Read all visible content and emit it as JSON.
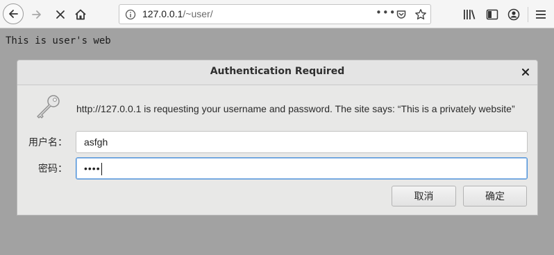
{
  "browser": {
    "url_host": "127.0.0.1",
    "url_path": "/~user/",
    "url_more": "•••",
    "icons": [
      "back-icon",
      "forward-icon",
      "stop-icon",
      "home-icon",
      "info-icon",
      "pocket-icon",
      "star-icon",
      "library-icon",
      "sidebar-icon",
      "account-icon",
      "menu-icon"
    ]
  },
  "page": {
    "body_text": "This is user's web"
  },
  "dialog": {
    "title": "Authentication Required",
    "message": "http://127.0.0.1 is requesting your username and password. The site says: “This is a privately website”",
    "username_label": "用户名：",
    "username_value": "asfgh",
    "password_label": "密码：",
    "password_value": "••••",
    "cancel_label": "取消",
    "ok_label": "确定"
  },
  "colors": {
    "page_background": "#a2a2a2",
    "toolbar_background": "#f5f5f5",
    "dialog_background": "#e8e8e7",
    "focus_border": "#4a90d9"
  }
}
